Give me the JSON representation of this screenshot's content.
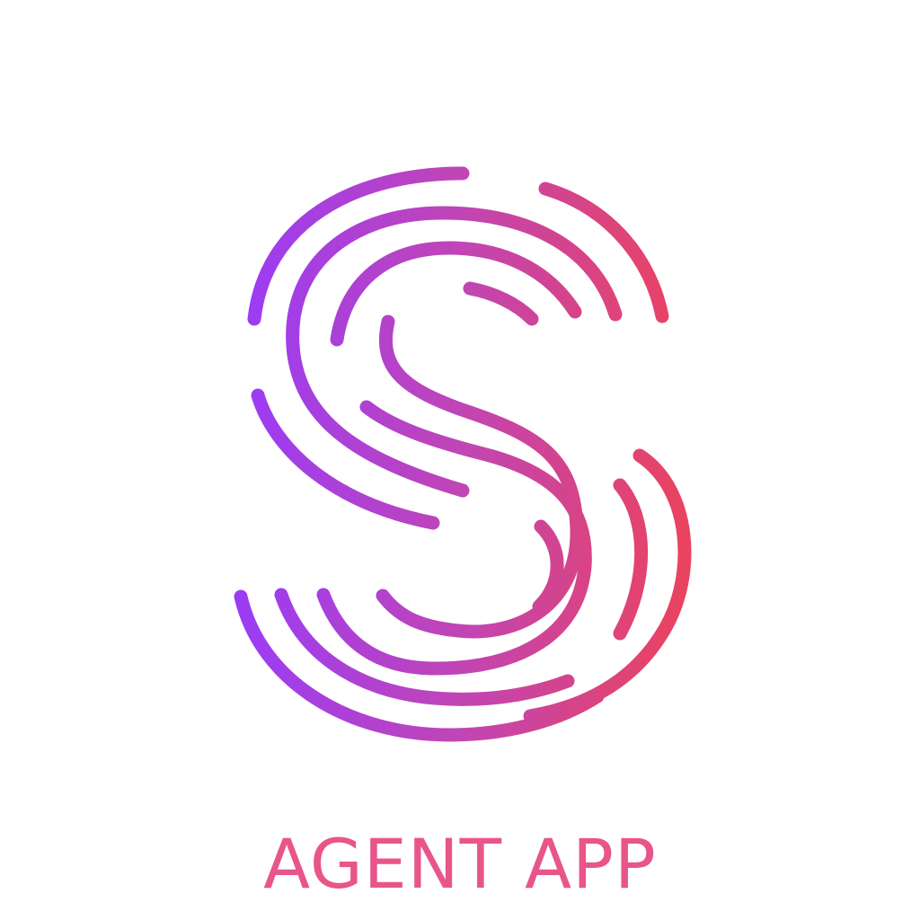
{
  "app": {
    "name": "AGENT APP"
  },
  "logo": {
    "icon": "fingerprint-s-logo-icon",
    "colors": {
      "gradient_start": "#9b3cf4",
      "gradient_mid": "#c145b4",
      "gradient_end": "#ea4360"
    }
  },
  "colors": {
    "background": "#ffffff",
    "app_name_text": "#e8558a"
  }
}
